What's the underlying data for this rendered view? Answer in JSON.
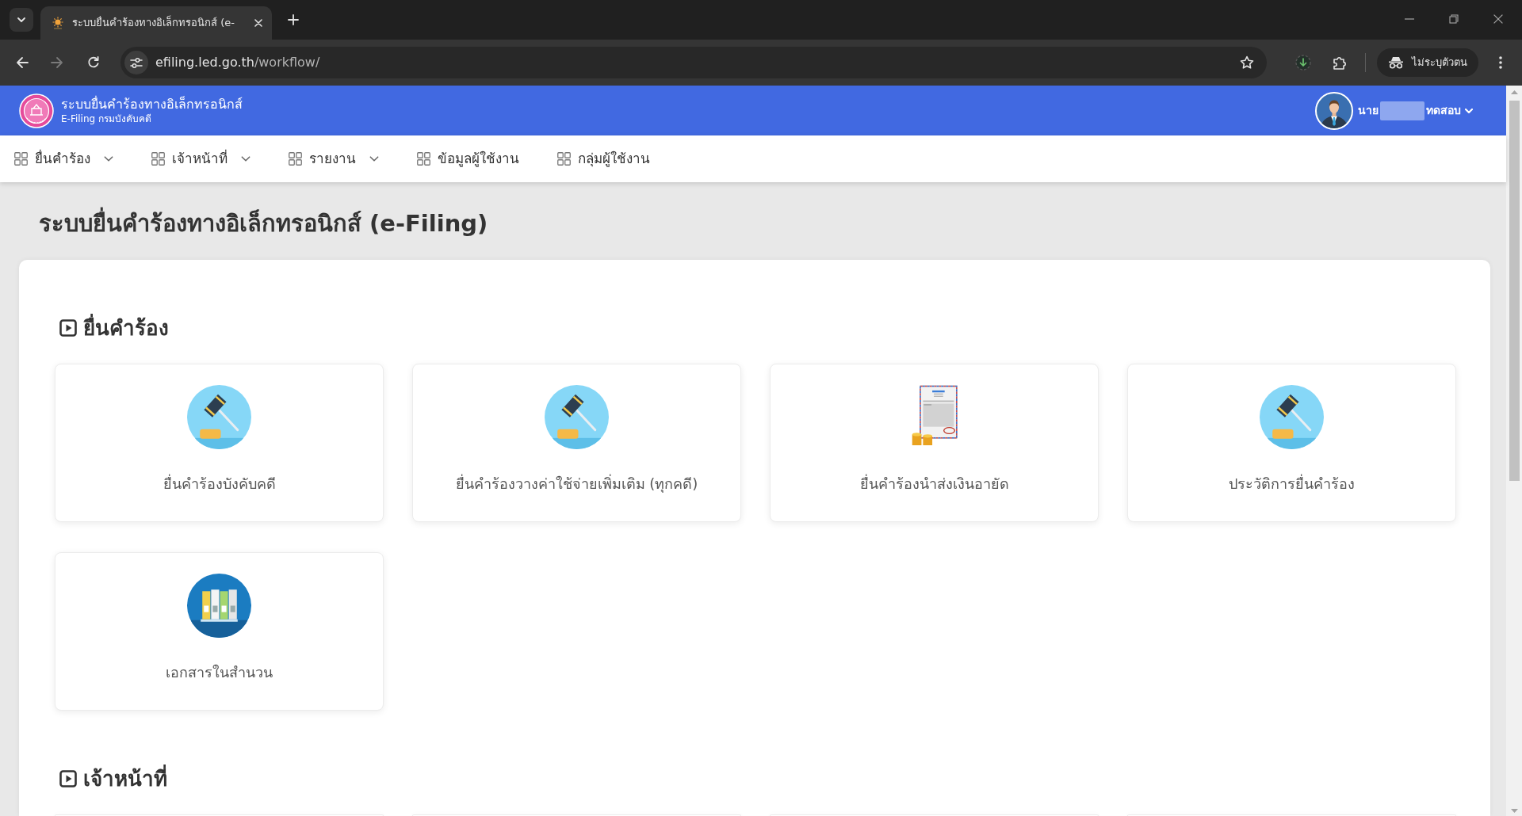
{
  "browser": {
    "tab": {
      "title": "ระบบยื่นคำร้องทางอิเล็กทรอนิกส์ (e-",
      "selected": true
    },
    "url": {
      "host": "efiling.led.go.th",
      "path": "/workflow/"
    },
    "profile_label": "ไม่ระบุตัวตน"
  },
  "header": {
    "title": "ระบบยื่นคำร้องทางอิเล็กทรอนิกส์",
    "subtitle": "E-Filing กรมบังคับคดี",
    "user": {
      "prefix": "นาย",
      "surname": "ทดสอบ",
      "redacted": true
    }
  },
  "nav": [
    {
      "label": "ยื่นคำร้อง",
      "dropdown": true
    },
    {
      "label": "เจ้าหน้าที่",
      "dropdown": true
    },
    {
      "label": "รายงาน",
      "dropdown": true
    },
    {
      "label": "ข้อมูลผู้ใช้งาน",
      "dropdown": false
    },
    {
      "label": "กลุ่มผู้ใช้งาน",
      "dropdown": false
    }
  ],
  "page_title": "ระบบยื่นคำร้องทางอิเล็กทรอนิกส์ (e-Filing)",
  "sections": [
    {
      "title": "ยื่นคำร้อง",
      "items": [
        {
          "kind": "gavel",
          "label": "ยื่นคำร้องบังคับคดี"
        },
        {
          "kind": "gavel",
          "label": "ยื่นคำร้องวางค่าใช้จ่ายเพิ่มเติม (ทุกคดี)"
        },
        {
          "kind": "invoice",
          "label": "ยื่นคำร้องนำส่งเงินอายัด"
        },
        {
          "kind": "gavel",
          "label": "ประวัติการยื่นคำร้อง"
        },
        {
          "kind": "binders",
          "label": "เอกสารในสำนวน"
        }
      ]
    },
    {
      "title": "เจ้าหน้าที่",
      "items": [
        {
          "kind": "stub"
        },
        {
          "kind": "stub"
        },
        {
          "kind": "stub"
        },
        {
          "kind": "stub"
        }
      ]
    }
  ]
}
